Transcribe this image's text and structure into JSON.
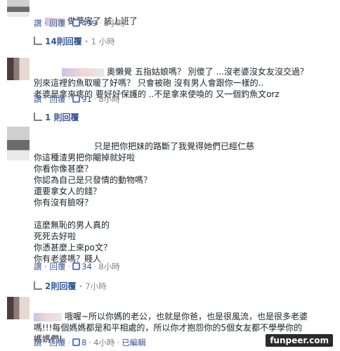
{
  "comments": [
    {
      "text": "做夢完了 該上班了",
      "actions": {
        "reply": "讚 · 回覆",
        "likes": "499",
        "time": "8小時"
      },
      "replies": {
        "label": "14則回覆",
        "time": "1 小時"
      }
    },
    {
      "name_suffix": "奧懶覺",
      "text": "五指姑娘嗎？ 別傻了 ...沒老婆沒女友沒交過？\n別來這裡釣魚取暖了好嗎？ 只會被砲 沒有男人會跟你一樣的..\n老婆是拿來疼的 要好好保護的 ..不是拿來使喚的 又一個釣魚文orz",
      "actions": {
        "reply": "讚 · 回覆",
        "likes": "91",
        "time": "8小時"
      },
      "replies": {
        "label": "1 則回覆"
      }
    },
    {
      "text": "只是把你把妹的路斷了我覺得她們已經仁慈\n你這種渣男把你閹掉就好啦\n你看你像甚麼？\n你認為自己是只發情的動物嗎？\n還要拿女人的錢？\n你有沒有臉呀？\n\n這麼無恥的男人真的\n死死去好啦\n你憑甚麼上來po文？\n你有老婆嗎？賤人",
      "actions": {
        "reply": "讚 · 回覆",
        "likes": "34",
        "time": "8小時"
      },
      "replies": {
        "label": "2則回覆",
        "time": "7小時"
      }
    },
    {
      "text": "哦喔~所以你媽的老公，也就是你爸，也是很風流，也是很多老婆\n嗎!!!每個媽媽都是和平相處的，所以你才抱怨你的5個女友都不學學你的\n媽媽們!",
      "actions": {
        "reply": "讚 · 回覆",
        "likes": "8",
        "time": "4小時",
        "edited": "已編輯"
      }
    }
  ],
  "watermark": "funpeer.com"
}
